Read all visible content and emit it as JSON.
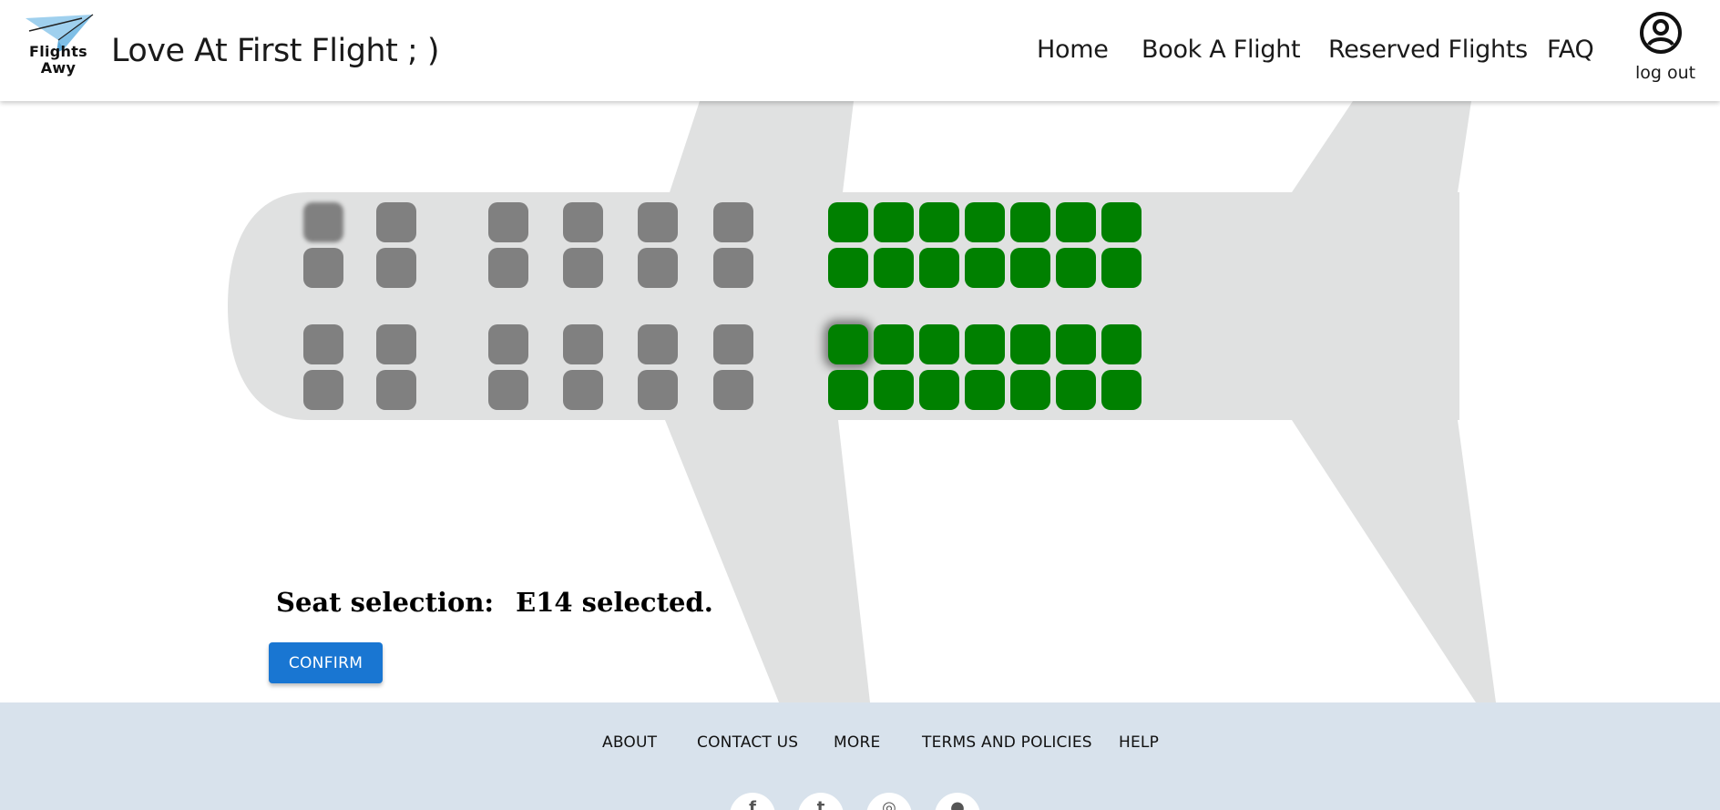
{
  "header": {
    "logo_text_line1": "Flights",
    "logo_text_line2": "Awy",
    "site_title": "Love At First Flight ; )",
    "nav": [
      "Home",
      "Book A Flight",
      "Reserved Flights",
      "FAQ"
    ],
    "user_icon": "account-circle-icon",
    "logout_label": "log out"
  },
  "seat_map": {
    "colors": {
      "unavailable": "#808080",
      "available": "#008000",
      "fuselage": "#e0e1e1"
    },
    "seats": [
      "unavailable-blurred",
      "unavailable",
      "unavailable",
      "unavailable",
      "unavailable",
      "unavailable",
      "available",
      "available",
      "available",
      "available",
      "available",
      "available",
      "available",
      "unavailable",
      "unavailable",
      "unavailable",
      "unavailable",
      "unavailable",
      "unavailable",
      "available",
      "available",
      "available",
      "available",
      "available",
      "available",
      "available",
      "unavailable",
      "unavailable",
      "unavailable",
      "unavailable",
      "unavailable",
      "unavailable",
      "available-selected",
      "available",
      "available",
      "available",
      "available",
      "available",
      "available",
      "unavailable",
      "unavailable",
      "unavailable",
      "unavailable",
      "unavailable",
      "unavailable",
      "available",
      "available",
      "available",
      "available",
      "available",
      "available",
      "available"
    ]
  },
  "selection": {
    "label": "Seat selection:",
    "status": "E14 selected."
  },
  "confirm_label": "CONFIRM",
  "footer": {
    "links": [
      "ABOUT",
      "CONTACT US",
      "MORE",
      "TERMS AND POLICIES",
      "HELP"
    ],
    "social_icons": [
      "facebook-icon",
      "twitter-icon",
      "instagram-icon",
      "github-icon"
    ]
  },
  "accent_color": "#1976d2",
  "footer_bg": "#d8e2ec"
}
